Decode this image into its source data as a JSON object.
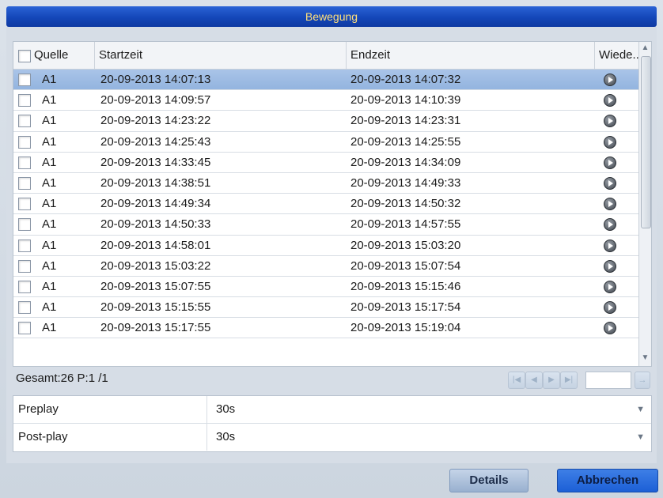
{
  "window": {
    "title": "Bewegung"
  },
  "table": {
    "headers": {
      "source": "Quelle",
      "start": "Startzeit",
      "end": "Endzeit",
      "playback": "Wiede.."
    },
    "rows": [
      {
        "source": "A1",
        "start": "20-09-2013 14:07:13",
        "end": "20-09-2013 14:07:32",
        "selected": true
      },
      {
        "source": "A1",
        "start": "20-09-2013 14:09:57",
        "end": "20-09-2013 14:10:39"
      },
      {
        "source": "A1",
        "start": "20-09-2013 14:23:22",
        "end": "20-09-2013 14:23:31"
      },
      {
        "source": "A1",
        "start": "20-09-2013 14:25:43",
        "end": "20-09-2013 14:25:55"
      },
      {
        "source": "A1",
        "start": "20-09-2013 14:33:45",
        "end": "20-09-2013 14:34:09"
      },
      {
        "source": "A1",
        "start": "20-09-2013 14:38:51",
        "end": "20-09-2013 14:49:33"
      },
      {
        "source": "A1",
        "start": "20-09-2013 14:49:34",
        "end": "20-09-2013 14:50:32"
      },
      {
        "source": "A1",
        "start": "20-09-2013 14:50:33",
        "end": "20-09-2013 14:57:55"
      },
      {
        "source": "A1",
        "start": "20-09-2013 14:58:01",
        "end": "20-09-2013 15:03:20"
      },
      {
        "source": "A1",
        "start": "20-09-2013 15:03:22",
        "end": "20-09-2013 15:07:54"
      },
      {
        "source": "A1",
        "start": "20-09-2013 15:07:55",
        "end": "20-09-2013 15:15:46"
      },
      {
        "source": "A1",
        "start": "20-09-2013 15:15:55",
        "end": "20-09-2013 15:17:54"
      },
      {
        "source": "A1",
        "start": "20-09-2013 15:17:55",
        "end": "20-09-2013 15:19:04"
      }
    ]
  },
  "pagination": {
    "total_text": "Gesamt:26 P:1 /1",
    "page_input": ""
  },
  "settings": [
    {
      "label": "Preplay",
      "value": "30s"
    },
    {
      "label": "Post-play",
      "value": "30s"
    }
  ],
  "buttons": {
    "details": "Details",
    "cancel": "Abbrechen"
  },
  "colors": {
    "title_bar": "#1446b8",
    "title_text": "#ffe07a",
    "selected_row": "#a9c4e8",
    "cancel_button": "#1c5fd6"
  },
  "icons": {
    "play": "play-circle-icon",
    "first": "first-page-icon",
    "prev": "prev-page-icon",
    "next": "next-page-icon",
    "last": "last-page-icon",
    "go": "go-icon"
  }
}
